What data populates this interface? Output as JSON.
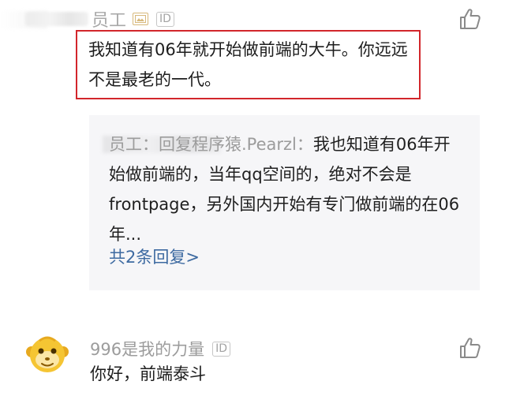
{
  "comment1": {
    "username_visible": "员工",
    "id_tag": "ID",
    "text": "我知道有06年就开始做前端的大牛。你远远不是最老的一代。"
  },
  "reply": {
    "prefix": "员工：回复程序猿.Pearzl：",
    "text": "我也知道有06年开始做前端的，当年qq空间的，绝对不会是frontpage，另外国内开始有专门做前端的在06年...",
    "count_link": "共2条回复>"
  },
  "comment2": {
    "username": "996是我的力量",
    "id_tag": "ID",
    "text": "你好，前端泰斗"
  },
  "colors": {
    "highlight_border": "#d2262b",
    "link_blue": "#3d6aa1",
    "panel_bg": "#f6f6f8",
    "avatar_yellow": "#f5c533"
  },
  "icons": {
    "like": "thumbs-up-icon",
    "badge": "image-badge-icon",
    "avatar": "monkey-avatar"
  }
}
